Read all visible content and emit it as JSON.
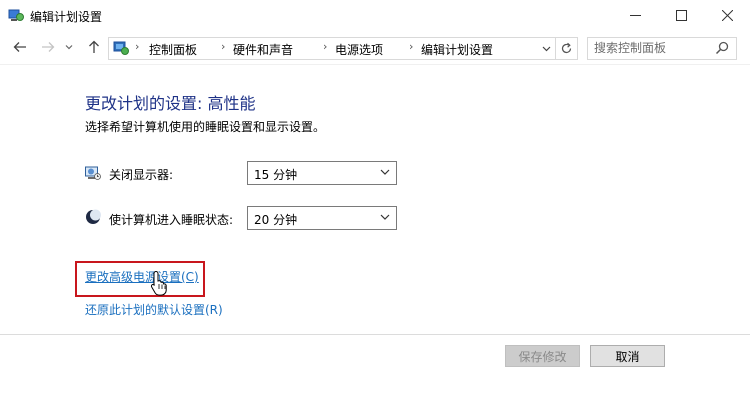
{
  "window": {
    "title": "编辑计划设置",
    "controls": [
      "minimize",
      "maximize",
      "close"
    ]
  },
  "nav": {
    "back_icon": "arrow-left-icon",
    "forward_icon": "arrow-right-icon",
    "recent_icon": "chevron-down-icon",
    "up_icon": "arrow-up-icon",
    "breadcrumbs": [
      "控制面板",
      "硬件和声音",
      "电源选项",
      "编辑计划设置"
    ],
    "search_placeholder": "搜索控制面板"
  },
  "content": {
    "heading": "更改计划的设置: 高性能",
    "subheading": "选择希望计算机使用的睡眠设置和显示设置。",
    "display_label": "关闭显示器:",
    "display_value": "15 分钟",
    "sleep_label": "使计算机进入睡眠状态:",
    "sleep_value": "20 分钟",
    "advanced_link": "更改高级电源设置(C)",
    "restore_link": "还原此计划的默认设置(R)"
  },
  "buttons": {
    "save": "保存修改",
    "cancel": "取消"
  },
  "colors": {
    "heading": "#1e3287",
    "link": "#1a6fbf",
    "highlight": "#c8161d"
  }
}
